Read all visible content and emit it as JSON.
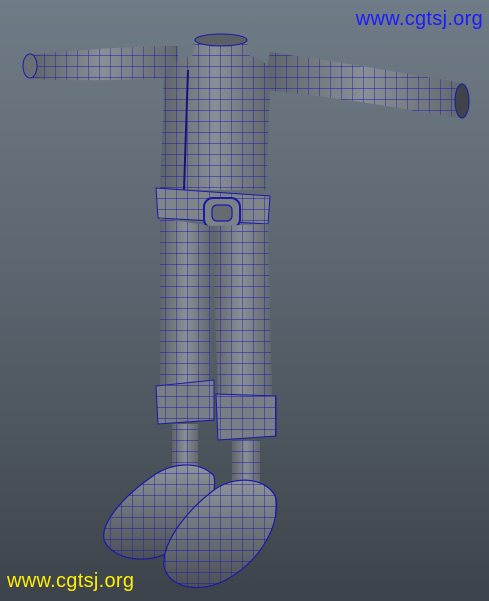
{
  "viewport": {
    "background_top": "#6f7b86",
    "background_bottom": "#3d434a"
  },
  "model": {
    "wire_color": "#1a1aa8",
    "fill_color": "#777c83"
  },
  "watermark_top": {
    "text": "www.cgtsj.org",
    "color": "#1c1cff"
  },
  "watermark_bottom": {
    "text": "www.cgtsj.org",
    "color": "#ffee00"
  }
}
